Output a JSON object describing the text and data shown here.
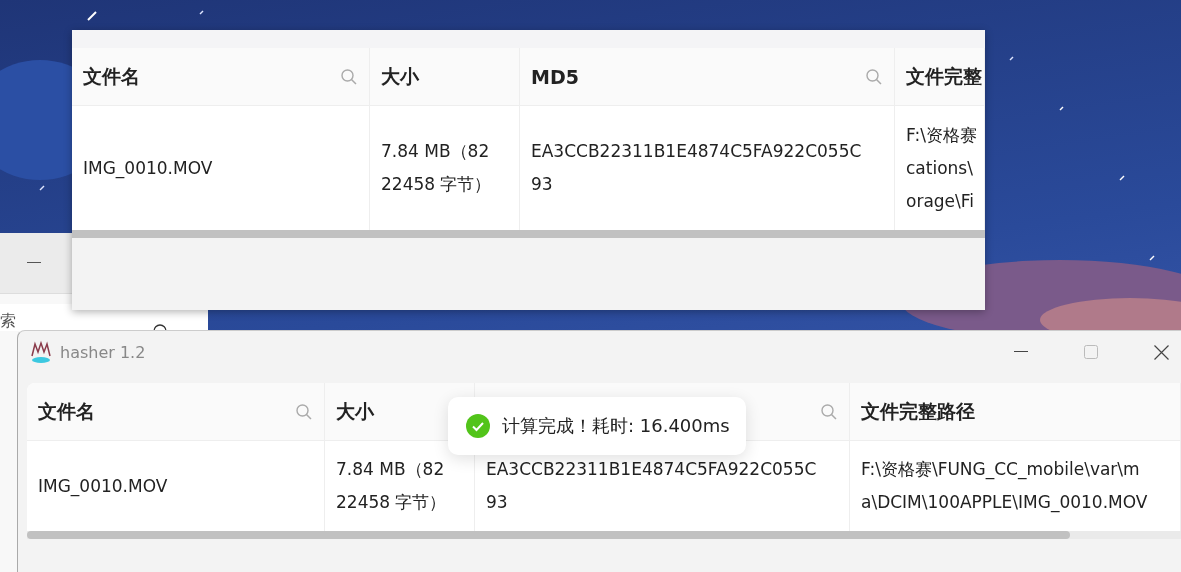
{
  "back_window": {
    "search_field": {
      "placeholder": "索"
    }
  },
  "table_window": {
    "columns": [
      {
        "label": "文件名",
        "searchable": true
      },
      {
        "label": "大小",
        "searchable": false
      },
      {
        "label": "MD5",
        "searchable": true
      },
      {
        "label": "文件完整"
      }
    ],
    "rows": [
      {
        "cells": [
          [
            "IMG_0010.MOV"
          ],
          [
            "7.84 MB（82",
            "22458 字节）"
          ],
          [
            "EA3CCB22311B1E4874C5FA922C055C",
            "93"
          ],
          [
            "F:\\资格赛",
            "cations\\",
            "orage\\Fi"
          ]
        ]
      }
    ]
  },
  "hasher_window": {
    "title": "hasher 1.2",
    "columns": [
      {
        "label": "文件名",
        "searchable": true
      },
      {
        "label": "大小",
        "searchable": false
      },
      {
        "searchable": true
      },
      {
        "label": "文件完整路径",
        "searchable": false
      }
    ],
    "rows": [
      {
        "cells": [
          [
            "IMG_0010.MOV"
          ],
          [
            "7.84 MB（82",
            "22458 字节）"
          ],
          [
            "EA3CCB22311B1E4874C5FA922C055C",
            "93"
          ],
          [
            "F:\\资格赛\\FUNG_CC_mobile\\var\\m",
            "a\\DCIM\\100APPLE\\IMG_0010.MOV"
          ]
        ]
      }
    ],
    "toast": {
      "kind": "success",
      "text": "计算完成！耗时: 16.400ms"
    }
  }
}
